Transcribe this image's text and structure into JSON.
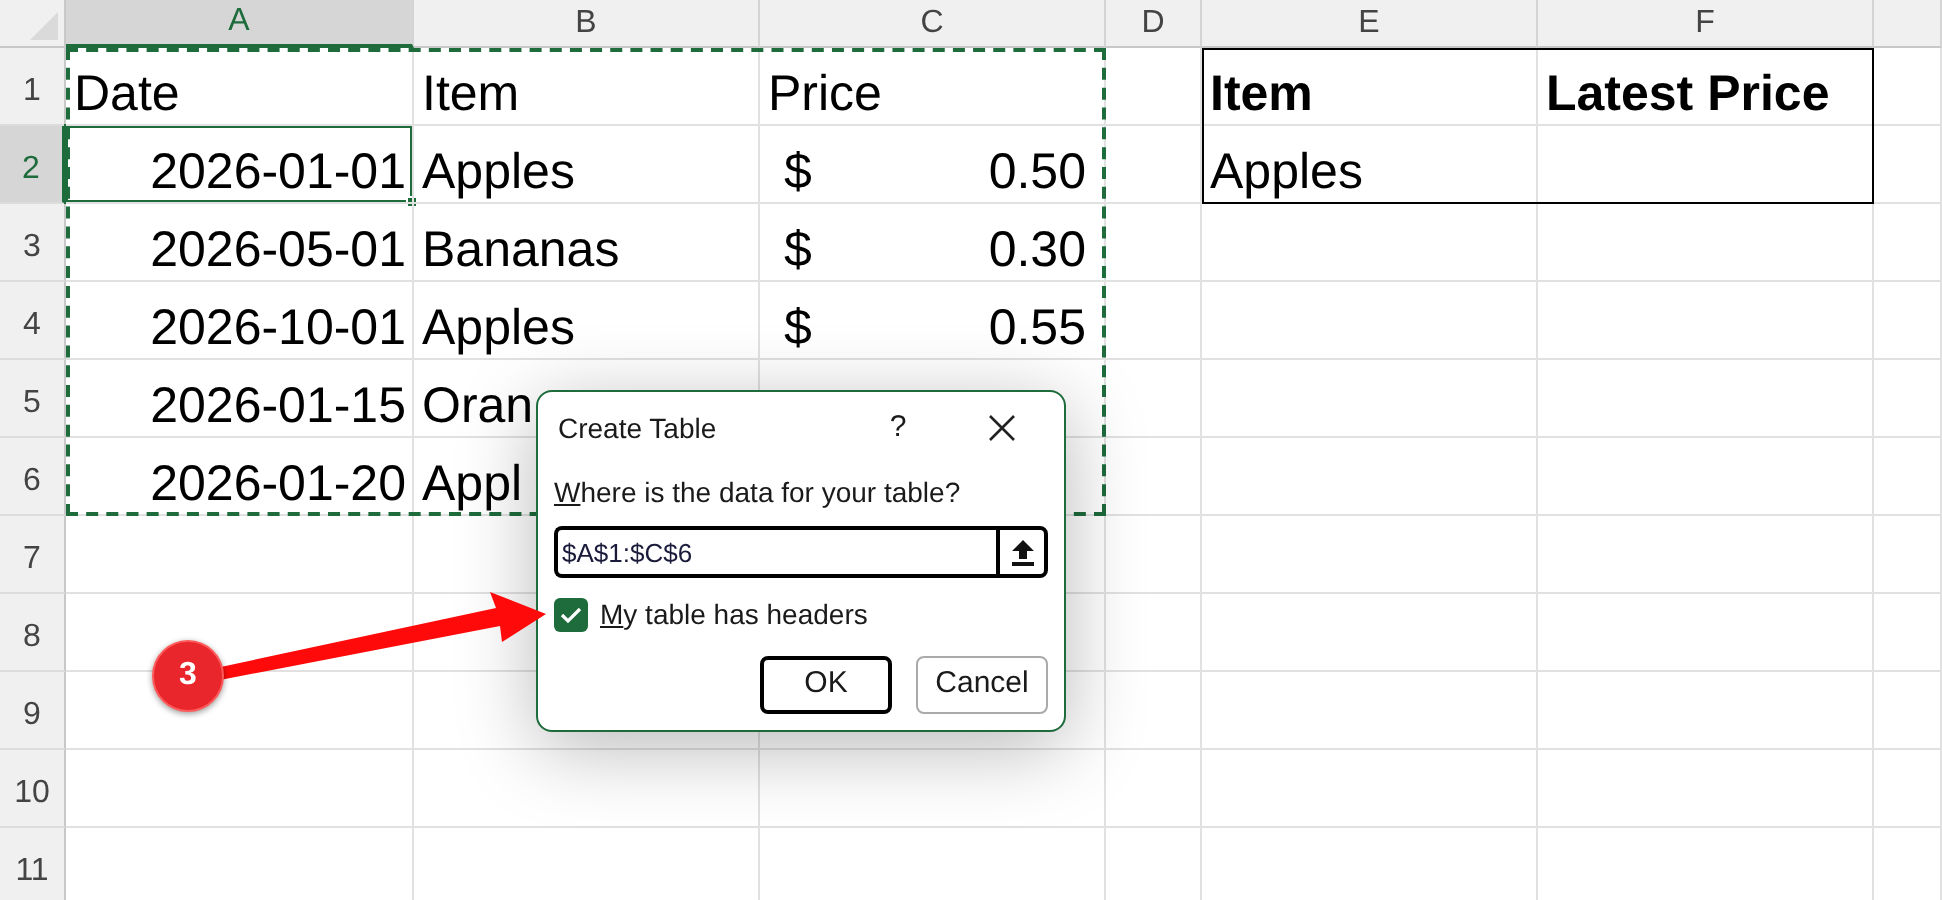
{
  "sheet": {
    "copy_marquee": true,
    "outlined_block": true,
    "columns": [
      {
        "label": "A",
        "selected": true
      },
      {
        "label": "B",
        "selected": false
      },
      {
        "label": "C",
        "selected": false
      },
      {
        "label": "D",
        "selected": false
      },
      {
        "label": "E",
        "selected": false
      },
      {
        "label": "F",
        "selected": false
      },
      {
        "selected": false
      }
    ],
    "rows": [
      {
        "label": "1",
        "selected": false,
        "cells": [
          {
            "kind": "text",
            "text": "Date"
          },
          {
            "kind": "text",
            "text": "Item"
          },
          {
            "kind": "text",
            "text": "Price"
          },
          null,
          {
            "kind": "heading",
            "text": "Item"
          },
          {
            "kind": "heading",
            "text": "Latest Price"
          }
        ]
      },
      {
        "label": "2",
        "selected": true,
        "cells": [
          {
            "kind": "date",
            "text": "2026-01-01"
          },
          {
            "kind": "text",
            "text": "Apples"
          },
          {
            "kind": "currency",
            "symbol": "$",
            "text": "0.50"
          },
          null,
          {
            "kind": "text",
            "text": "Apples"
          }
        ]
      },
      {
        "label": "3",
        "selected": false,
        "cells": [
          {
            "kind": "date",
            "text": "2026-05-01"
          },
          {
            "kind": "text",
            "text": "Bananas"
          },
          {
            "kind": "currency",
            "symbol": "$",
            "text": "0.30"
          }
        ]
      },
      {
        "label": "4",
        "selected": false,
        "cells": [
          {
            "kind": "date",
            "text": "2026-10-01"
          },
          {
            "kind": "text",
            "text": "Apples"
          },
          {
            "kind": "currency",
            "symbol": "$",
            "text": "0.55"
          }
        ]
      },
      {
        "label": "5",
        "selected": false,
        "cells": [
          {
            "kind": "date",
            "text": "2026-01-15"
          },
          {
            "kind": "text",
            "text": "Oran"
          }
        ]
      },
      {
        "label": "6",
        "selected": false,
        "cells": [
          {
            "kind": "date",
            "text": "2026-01-20"
          },
          {
            "kind": "text",
            "text": "Appl"
          }
        ]
      },
      {
        "label": "7",
        "selected": false,
        "cells": []
      },
      {
        "label": "8",
        "selected": false,
        "cells": []
      },
      {
        "label": "9",
        "selected": false,
        "cells": []
      },
      {
        "label": "10",
        "selected": false,
        "cells": []
      },
      {
        "label": "11",
        "selected": false,
        "cells": []
      }
    ]
  },
  "dialog": {
    "title": "Create Table",
    "help": "?",
    "prompt": "Where is the data for your table?",
    "range": "$A$1:$C$6",
    "checkbox": {
      "label": "My table has headers",
      "checked": true
    },
    "buttons": [
      "OK",
      "Cancel"
    ]
  },
  "callout": {
    "kind": "step",
    "text": "3"
  }
}
